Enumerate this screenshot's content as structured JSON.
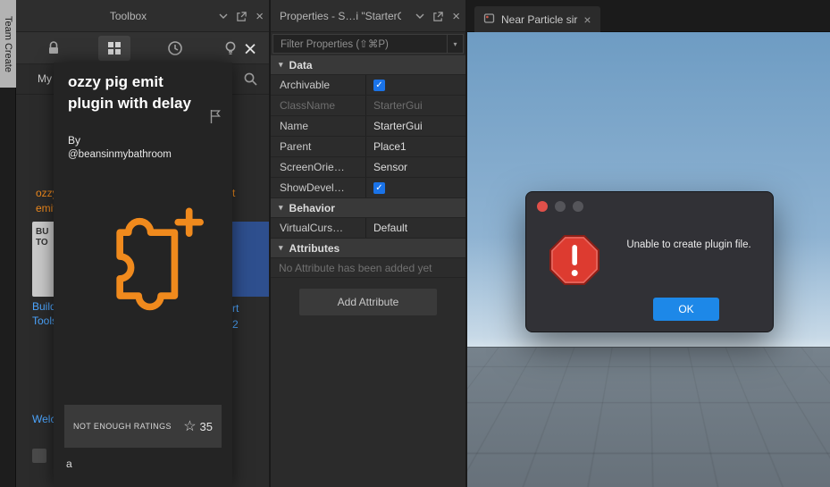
{
  "colors": {
    "accent_orange": "#f08a1d",
    "checkbox_blue": "#1a73e8",
    "ok_button_blue": "#1d88e8",
    "error_red": "#dd3b30",
    "link_blue": "#4da6ff"
  },
  "team_create": {
    "label": "Team Create"
  },
  "toolbox": {
    "title": "Toolbox",
    "search_value": "My",
    "results": {
      "plugin_name_line1": "ozzy pig e",
      "plugin_name_line2": "emit plug",
      "frag_right_top": "t",
      "thumb_left_line1": "BU",
      "thumb_left_line2": "TO",
      "link_left_line1": "Building",
      "link_left_line2": "Tools by",
      "frag_right_mid1": "rt",
      "frag_right_mid2": "2",
      "link_bottom": "Welcome"
    }
  },
  "overlay": {
    "title": "ozzy pig emit plugin with delay",
    "by_label": "By",
    "author": "@beansinmybathroom",
    "rating_label": "NOT ENOUGH RATINGS",
    "rating_count": "35",
    "footnote": "a"
  },
  "properties": {
    "title": "Properties - S…i \"StarterGui\"",
    "filter_placeholder": "Filter Properties (⇧⌘P)",
    "section_data": "Data",
    "section_behavior": "Behavior",
    "section_attributes": "Attributes",
    "rows": [
      {
        "name": "Archivable",
        "value": ""
      },
      {
        "name": "ClassName",
        "value": "StarterGui"
      },
      {
        "name": "Name",
        "value": "StarterGui"
      },
      {
        "name": "Parent",
        "value": "Place1"
      },
      {
        "name": "ScreenOrie…",
        "value": "Sensor"
      },
      {
        "name": "ShowDevel…",
        "value": ""
      }
    ],
    "behavior_rows": [
      {
        "name": "VirtualCurs…",
        "value": "Default"
      }
    ],
    "no_attribute_text": "No Attribute has been added yet",
    "add_attribute_label": "Add Attribute"
  },
  "viewport": {
    "tab_label": "Near Particle sir"
  },
  "dialog": {
    "message": "Unable to create plugin file.",
    "ok_label": "OK"
  }
}
